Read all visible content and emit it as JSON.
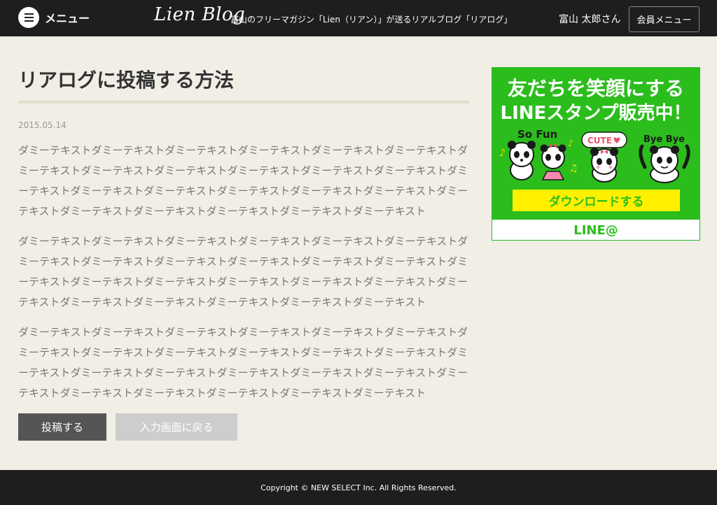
{
  "header": {
    "menu_label": "メニュー",
    "logo_text": "Lien Blog",
    "tagline": "富山のフリーマガジン「Lien（リアン）」が送るリアルブログ「リアログ」",
    "username": "富山 太郎さん",
    "member_menu_label": "会員メニュー"
  },
  "post": {
    "title": "リアログに投稿する方法",
    "date": "2015.05.14",
    "paragraphs": [
      "ダミーテキストダミーテキストダミーテキストダミーテキストダミーテキストダミーテキストダミーテキストダミーテキストダミーテキストダミーテキストダミーテキストダミーテキストダミーテキストダミーテキストダミーテキストダミーテキストダミーテキストダミーテキストダミーテキストダミーテキストダミーテキストダミーテキストダミーテキストダミーテキスト",
      "ダミーテキストダミーテキストダミーテキストダミーテキストダミーテキストダミーテキストダミーテキストダミーテキストダミーテキストダミーテキストダミーテキストダミーテキストダミーテキストダミーテキストダミーテキストダミーテキストダミーテキストダミーテキストダミーテキストダミーテキストダミーテキストダミーテキストダミーテキストダミーテキスト",
      "ダミーテキストダミーテキストダミーテキストダミーテキストダミーテキストダミーテキストダミーテキストダミーテキストダミーテキストダミーテキストダミーテキストダミーテキストダミーテキストダミーテキストダミーテキストダミーテキストダミーテキストダミーテキストダミーテキストダミーテキストダミーテキストダミーテキストダミーテキストダミーテキスト"
    ]
  },
  "actions": {
    "post_label": "投稿する",
    "back_label": "入力画面に戻る"
  },
  "banner": {
    "line1": "友だちを笑顔にする",
    "line2": "LINEスタンプ販売中！",
    "sticker_labels": [
      "So Fun",
      "CUTE",
      "Bye Bye"
    ],
    "download_label": "ダウンロードする",
    "brand": "LINE@",
    "colors": {
      "green": "#2bbd1c",
      "yellow": "#fff000"
    }
  },
  "footer": {
    "copyright": "Copyright © NEW SELECT Inc. All Rights Reserved."
  },
  "theme": {
    "header_bg": "#1e1e1e",
    "page_bg": "#f1eee6",
    "post_button_bg": "#555555",
    "back_button_bg": "#cdcdcd"
  }
}
